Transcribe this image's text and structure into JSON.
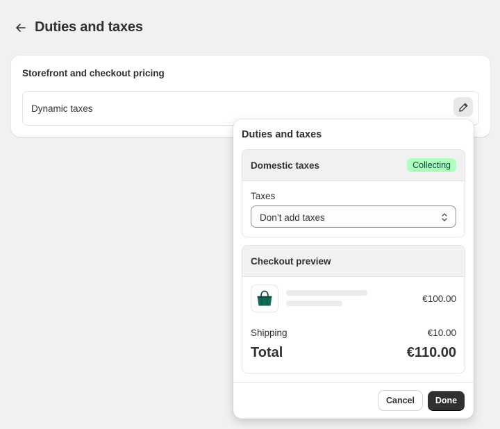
{
  "page": {
    "title": "Duties and taxes",
    "back_icon": "arrow-left-icon"
  },
  "card": {
    "heading": "Storefront and checkout pricing",
    "row_label": "Dynamic taxes",
    "edit_icon": "pencil-icon"
  },
  "popover": {
    "title": "Duties and taxes",
    "domestic": {
      "title": "Domestic taxes",
      "badge": "Collecting",
      "badge_bg": "#affebf",
      "badge_fg": "#014b40",
      "field_label": "Taxes",
      "select_value": "Don’t add taxes",
      "select_icon": "select-chevrons-icon"
    },
    "preview": {
      "title": "Checkout preview",
      "product_icon": "shopping-bag-icon",
      "product_price": "€100.00",
      "shipping_label": "Shipping",
      "shipping_value": "€10.00",
      "total_label": "Total",
      "total_value": "€110.00"
    },
    "footer": {
      "cancel_label": "Cancel",
      "done_label": "Done"
    }
  },
  "colors": {
    "background": "#f1f1f1",
    "primary_button": "#303030",
    "bag_green": "#0f6b57"
  }
}
